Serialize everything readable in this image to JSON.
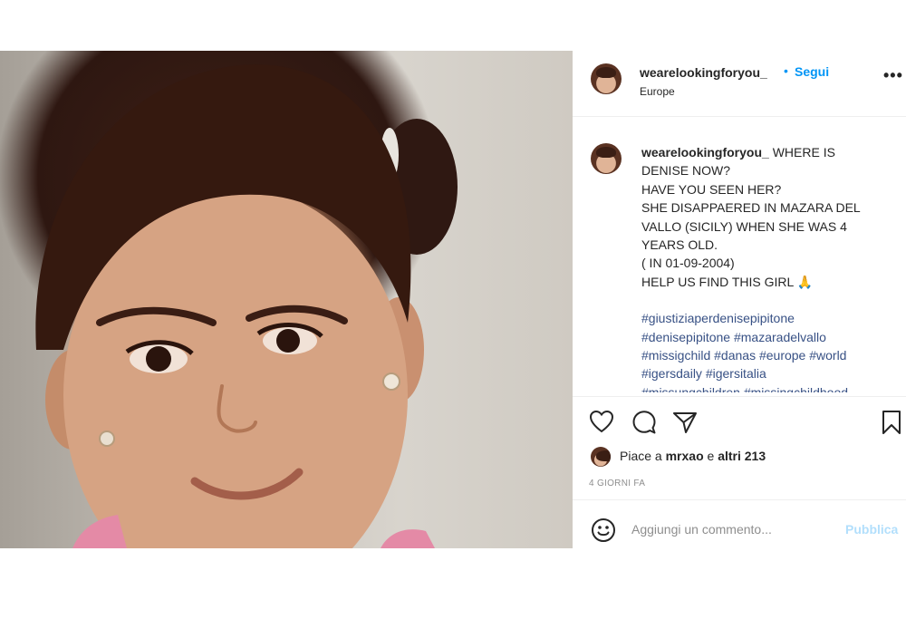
{
  "post": {
    "username": "wearelookingforyou_",
    "follow_dot": "•",
    "follow_label": "Segui",
    "location": "Europe",
    "more_label": "•••",
    "caption": {
      "user": "wearelookingforyou_",
      "lines": [
        "WHERE IS",
        "DENISE NOW?",
        "HAVE YOU SEEN HER?",
        "SHE DISAPPAERED IN MAZARA DEL",
        "VALLO (SICILY) WHEN SHE WAS 4",
        "YEARS OLD.",
        "( IN 01-09-2004)",
        "HELP US FIND THIS GIRL 🙏"
      ],
      "hashtags": [
        "#giustiziaperdenisepipitone",
        "#denisepipitone #mazaradelvallo",
        "#missigchild #danas #europe #world",
        "#igersdaily #igersitalia",
        "#missungchildren #missingchildhood"
      ]
    },
    "likes": {
      "prefix": "Piace a ",
      "user": "mrxao",
      "middle": " e ",
      "others": "altri 213"
    },
    "date": "4 GIORNI FA",
    "comment_placeholder": "Aggiungi un commento...",
    "publish_label": "Pubblica"
  },
  "icons": {
    "like": "heart-icon",
    "comment": "comment-icon",
    "share": "send-icon",
    "save": "bookmark-icon",
    "emoji": "emoji-icon",
    "more": "more-icon"
  },
  "colors": {
    "link_blue": "#0095f6",
    "hashtag": "#385185",
    "muted": "#8e8e8e",
    "publish_disabled": "#b2dffc"
  }
}
